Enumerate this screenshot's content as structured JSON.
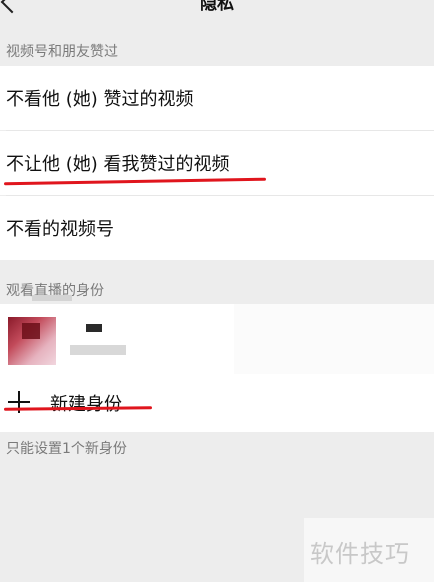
{
  "nav": {
    "title": "隐私",
    "back_icon": "chevron-left-icon"
  },
  "sections": {
    "channels_likes": {
      "label": "视频号和朋友赞过",
      "items": [
        {
          "label": "不看他 (她) 赞过的视频"
        },
        {
          "label": "不让他 (她) 看我赞过的视频"
        },
        {
          "label": "不看的视频号"
        }
      ]
    },
    "live_identity": {
      "label": "观看直播的身份",
      "new_identity_label": "新建身份",
      "footer_note": "只能设置1个新身份"
    }
  },
  "watermark": "软件技巧",
  "colors": {
    "background": "#ededed",
    "row": "#ffffff",
    "annotation_red": "#e0151d"
  }
}
